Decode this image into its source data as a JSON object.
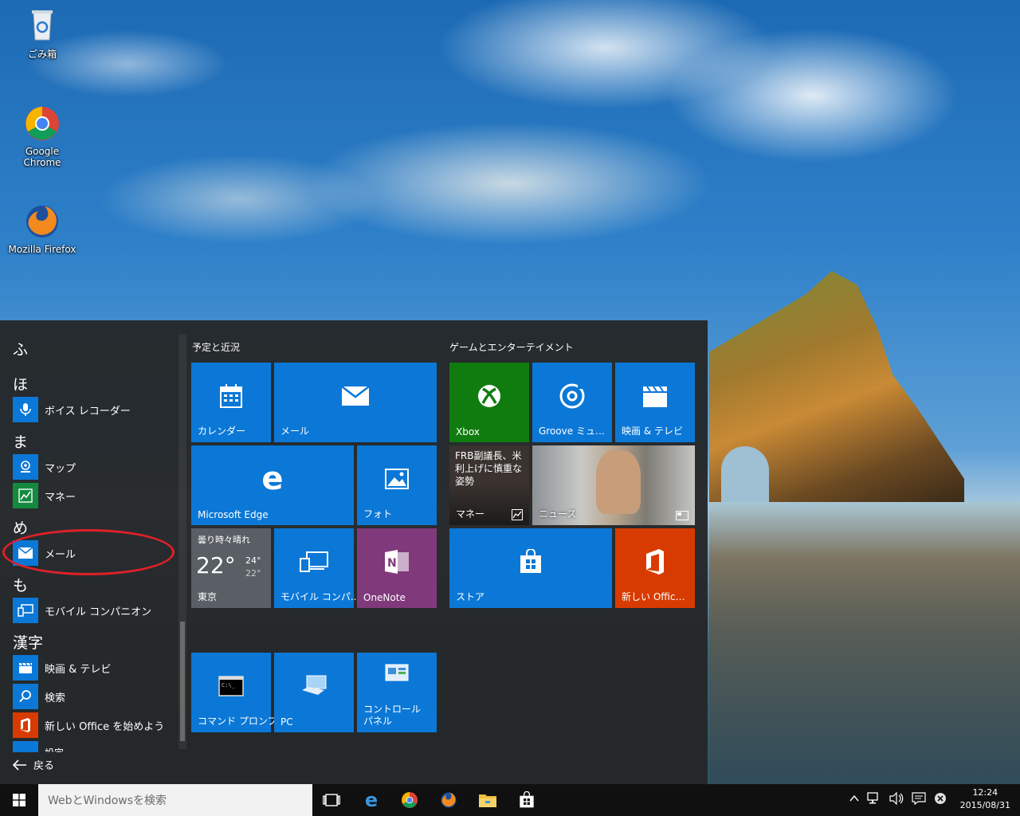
{
  "desktop": {
    "icons": [
      {
        "label": "ごみ箱"
      },
      {
        "label": "Google Chrome"
      },
      {
        "label": "Mozilla Firefox"
      }
    ]
  },
  "start_menu": {
    "app_list": [
      {
        "type": "letter",
        "text": "ふ"
      },
      {
        "type": "letter",
        "text": "ほ"
      },
      {
        "type": "app",
        "text": "ボイス レコーダー",
        "icon": "microphone-icon"
      },
      {
        "type": "letter",
        "text": "ま"
      },
      {
        "type": "app",
        "text": "マップ",
        "icon": "map-icon"
      },
      {
        "type": "app",
        "text": "マネー",
        "icon": "chart-icon"
      },
      {
        "type": "letter",
        "text": "め"
      },
      {
        "type": "app",
        "text": "メール",
        "icon": "mail-icon"
      },
      {
        "type": "letter",
        "text": "も"
      },
      {
        "type": "app",
        "text": "モバイル コンパニオン",
        "icon": "mobile-icon"
      },
      {
        "type": "letter",
        "text": "漢字"
      },
      {
        "type": "app",
        "text": "映画 & テレビ",
        "icon": "clapper-icon"
      },
      {
        "type": "app",
        "text": "検索",
        "icon": "search-icon"
      },
      {
        "type": "app",
        "text": "新しい Office を始めよう",
        "icon": "office-icon"
      },
      {
        "type": "app",
        "text": "設定",
        "icon": "gear-icon"
      }
    ],
    "back_label": "戻る",
    "groups": {
      "left_title": "予定と近況",
      "right_title": "ゲームとエンターテイメント"
    },
    "tiles": {
      "calendar": "カレンダー",
      "mail": "メール",
      "edge": "Microsoft Edge",
      "photos": "フォト",
      "weather_cond": "曇り時々晴れ",
      "weather_temp": "22°",
      "weather_high": "24°",
      "weather_low": "22°",
      "weather_city": "東京",
      "mobile": "モバイル コンパ...",
      "onenote": "OneNote",
      "cmd": "コマンド プロンプト",
      "pc": "PC",
      "control_panel": "コントロール パネル",
      "xbox": "Xbox",
      "groove": "Groove ミュージ...",
      "movies": "映画 & テレビ",
      "money_headline": "FRB副議長、米利上げに慎重な姿勢",
      "money": "マネー",
      "news": "ニュース",
      "store": "ストア",
      "office": "新しい Office..."
    }
  },
  "taskbar": {
    "search_placeholder": "WebとWindowsを検索",
    "time": "12:24",
    "date": "2015/08/31"
  },
  "colors": {
    "tile_blue": "#0b78d7",
    "xbox_green": "#107c10",
    "onenote_purple": "#80397b",
    "office_orange": "#d83b01",
    "highlight_red": "#e0202a"
  }
}
